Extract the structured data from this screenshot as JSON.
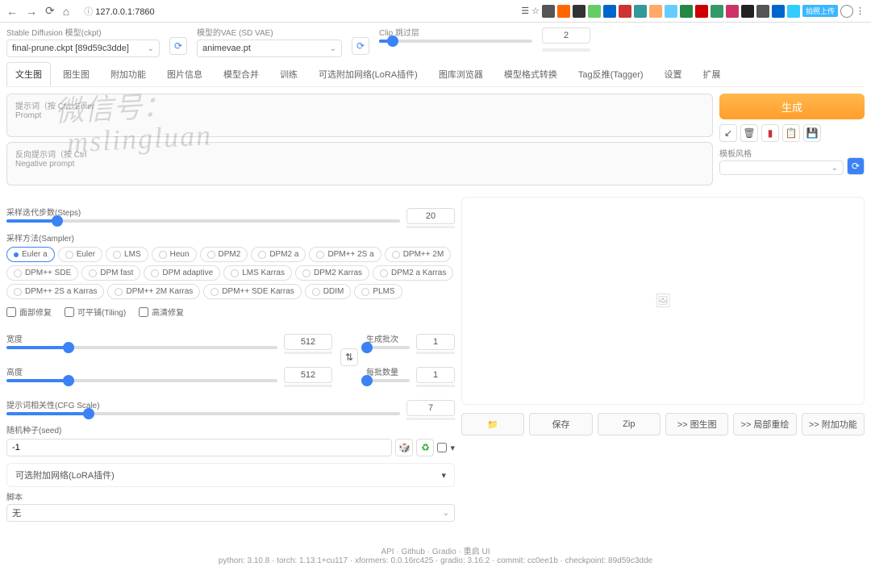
{
  "browser": {
    "url_prefix": "ⓘ ",
    "url": "127.0.0.1:7860",
    "badge": "拍照上传"
  },
  "top": {
    "model_label": "Stable Diffusion 模型(ckpt)",
    "model_value": "final-prune.ckpt [89d59c3dde]",
    "vae_label": "模型的VAE (SD VAE)",
    "vae_value": "animevae.pt",
    "clip_label": "Clip 跳过层",
    "clip_value": "2"
  },
  "tabs": [
    "文生图",
    "图生图",
    "附加功能",
    "图片信息",
    "模型合并",
    "训练",
    "可选附加网络(LoRA插件)",
    "图库浏览器",
    "模型格式转换",
    "Tag反推(Tagger)",
    "设置",
    "扩展"
  ],
  "watermark1": "微信号：",
  "watermark2": "mslingluan",
  "prompt": {
    "label": "提示词（按 Ctrl+Enter",
    "sub": "Prompt"
  },
  "neg_prompt": {
    "label": "反向提示词（按 Ctrl",
    "sub": "Negative prompt"
  },
  "generate": "生成",
  "template_label": "模板风格",
  "steps": {
    "label": "采样迭代步数(Steps)",
    "value": "20"
  },
  "sampler": {
    "label": "采样方法(Sampler)",
    "options": [
      "Euler a",
      "Euler",
      "LMS",
      "Heun",
      "DPM2",
      "DPM2 a",
      "DPM++ 2S a",
      "DPM++ 2M",
      "DPM++ SDE",
      "DPM fast",
      "DPM adaptive",
      "LMS Karras",
      "DPM2 Karras",
      "DPM2 a Karras",
      "DPM++ 2S a Karras",
      "DPM++ 2M Karras",
      "DPM++ SDE Karras",
      "DDIM",
      "PLMS"
    ],
    "selected": "Euler a"
  },
  "checks": {
    "face": "面部修复",
    "tiling": "可平铺(Tiling)",
    "hires": "高清修复"
  },
  "width": {
    "label": "宽度",
    "value": "512"
  },
  "height": {
    "label": "高度",
    "value": "512"
  },
  "batch_count": {
    "label": "生成批次",
    "value": "1"
  },
  "batch_size": {
    "label": "每批数量",
    "value": "1"
  },
  "cfg": {
    "label": "提示词相关性(CFG Scale)",
    "value": "7"
  },
  "seed": {
    "label": "随机种子(seed)",
    "value": "-1"
  },
  "lora": {
    "title": "可选附加网络(LoRA插件)",
    "script_label": "脚本",
    "script_value": "无"
  },
  "actions": {
    "folder": "📁",
    "save": "保存",
    "zip": "Zip",
    "to_img2img": ">> 图生图",
    "to_inpaint": ">> 局部重绘",
    "to_extras": ">> 附加功能"
  },
  "footer": {
    "links": "API · Github · Gradio · 重启 UI",
    "info": "python: 3.10.8 · torch: 1.13.1+cu117 · xformers: 0.0.16rc425 · gradio: 3.16.2 · commit: cc0ee1b · checkpoint: 89d59c3dde"
  },
  "chart_data": {
    "type": "ui-sliders",
    "sliders": [
      {
        "name": "clip_skip",
        "min": 1,
        "max": 12,
        "value": 2
      },
      {
        "name": "steps",
        "min": 1,
        "max": 150,
        "value": 20
      },
      {
        "name": "width",
        "min": 64,
        "max": 2048,
        "value": 512
      },
      {
        "name": "height",
        "min": 64,
        "max": 2048,
        "value": 512
      },
      {
        "name": "batch_count",
        "min": 1,
        "max": 100,
        "value": 1
      },
      {
        "name": "batch_size",
        "min": 1,
        "max": 8,
        "value": 1
      },
      {
        "name": "cfg_scale",
        "min": 1,
        "max": 30,
        "value": 7
      }
    ]
  }
}
